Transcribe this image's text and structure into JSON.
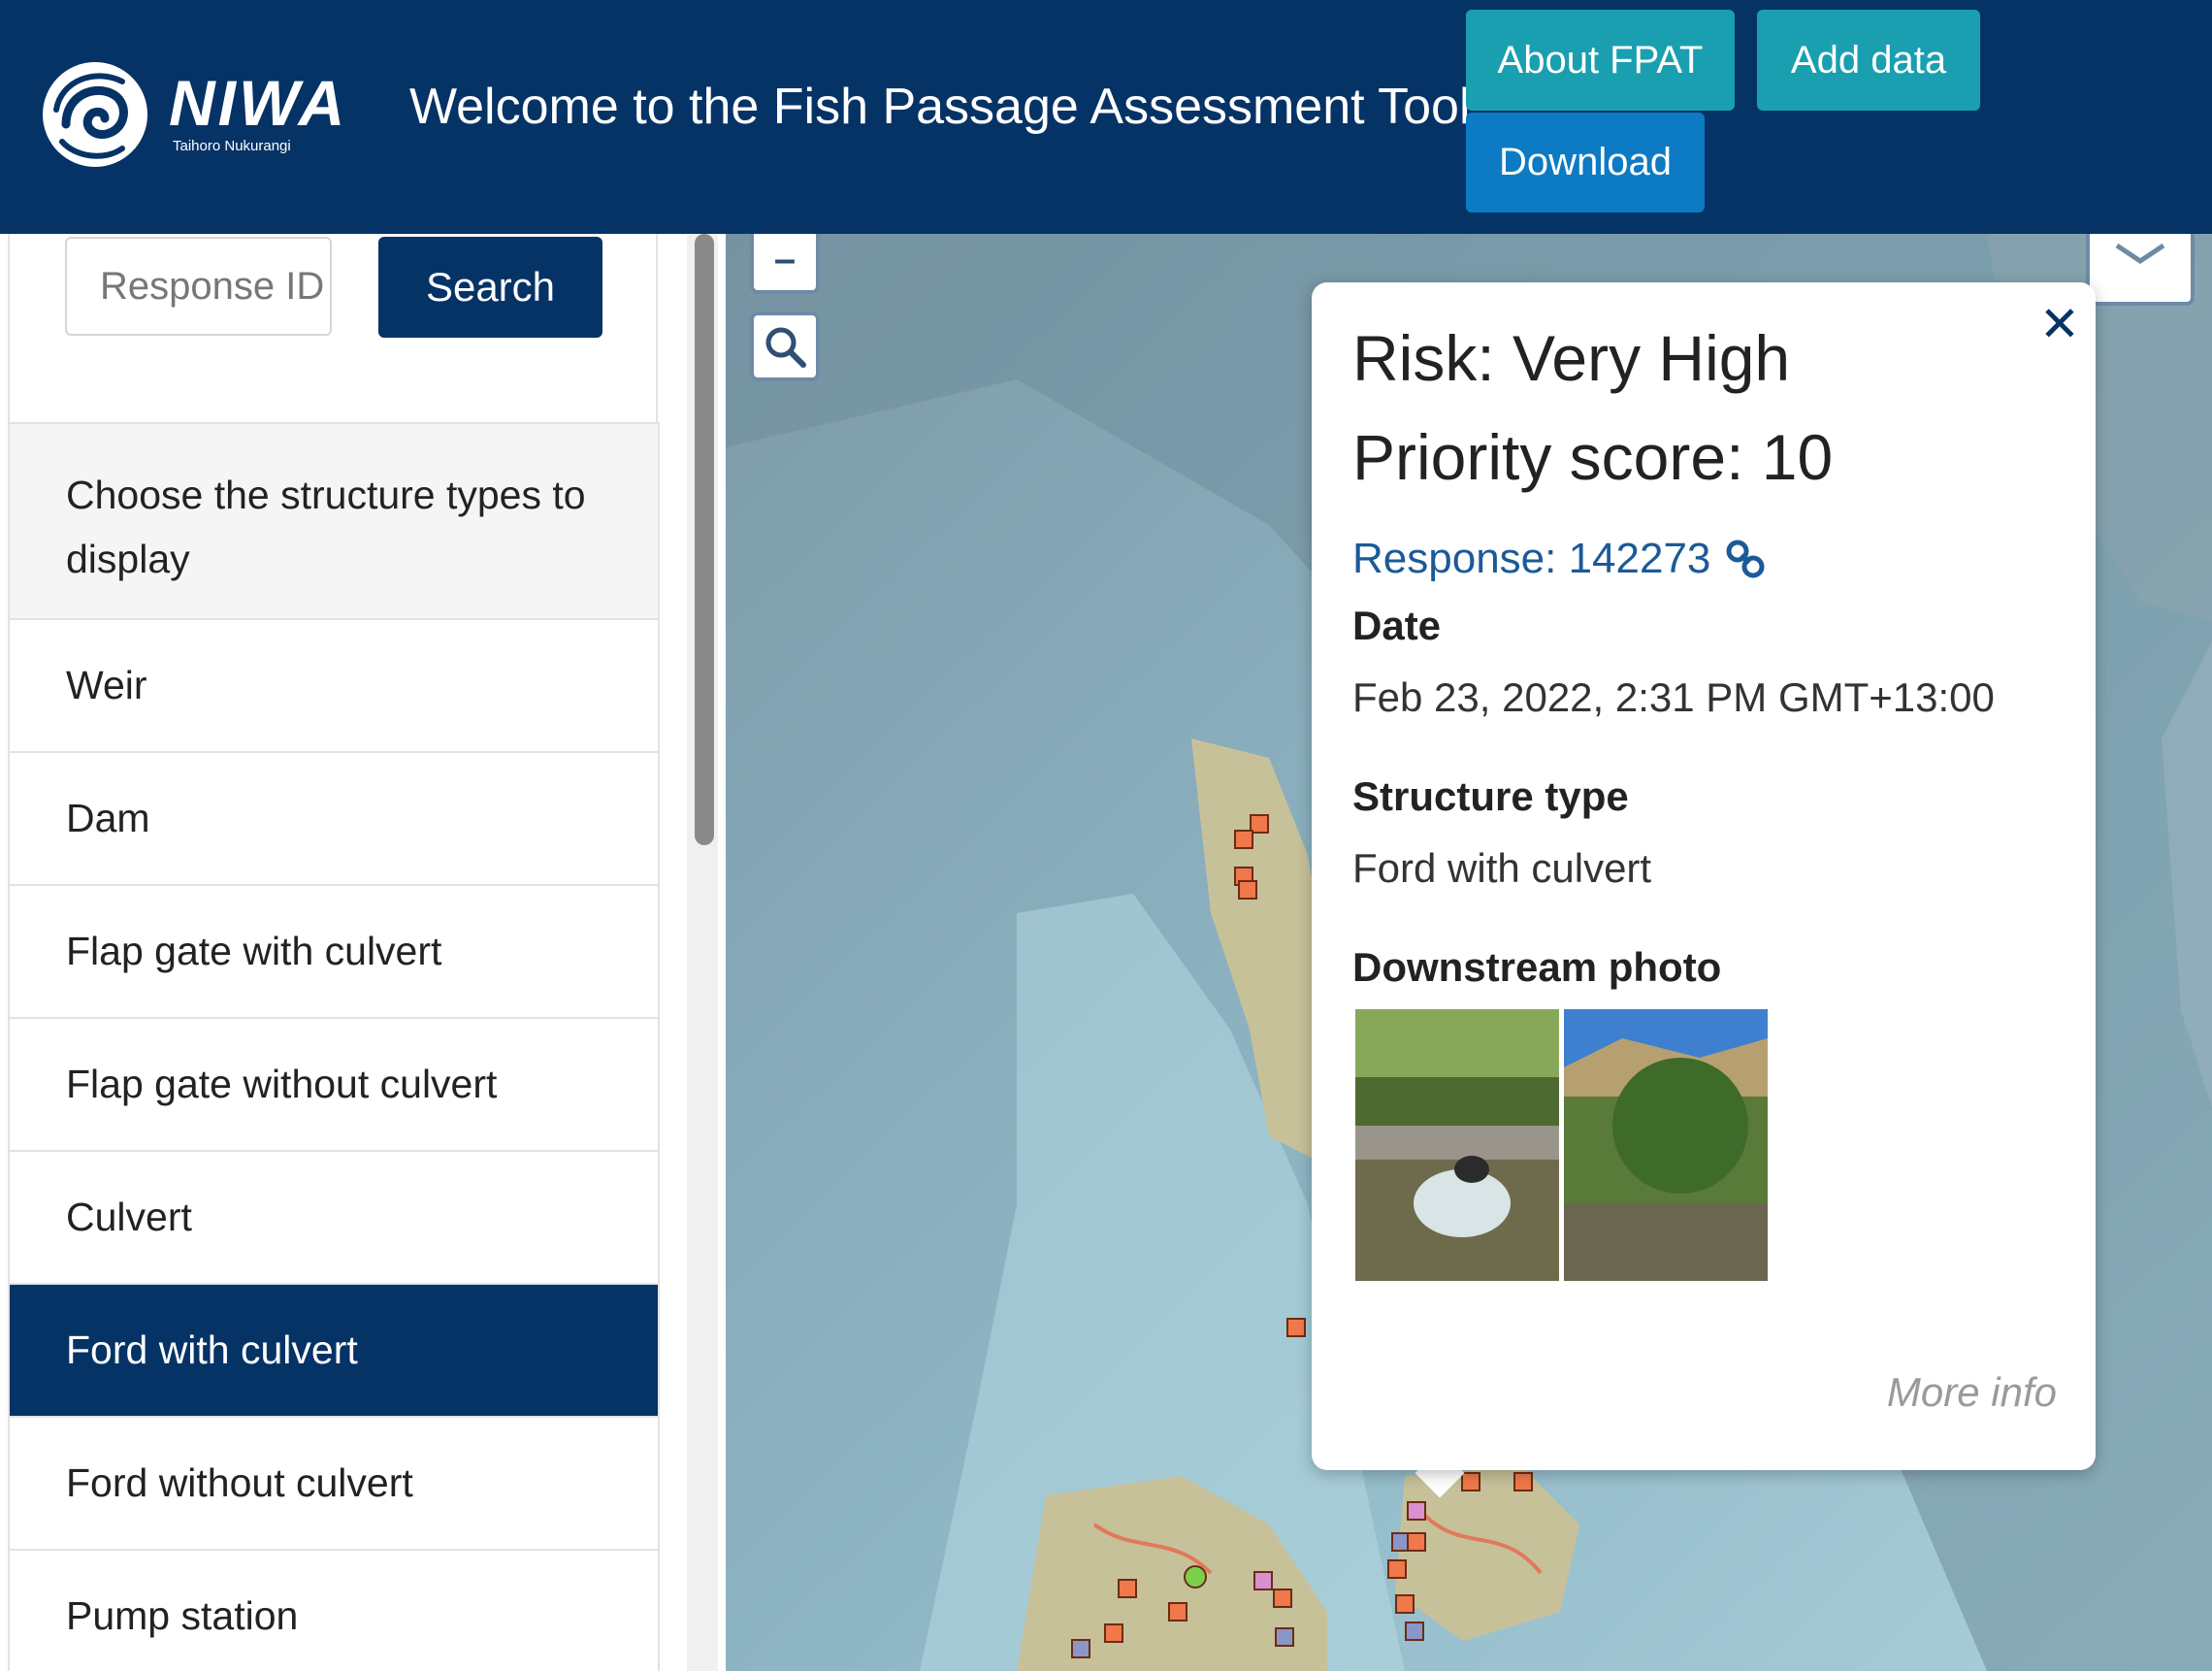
{
  "header": {
    "logo_text": "NIWA",
    "logo_subtext": "Taihoro Nukurangi",
    "title": "Welcome to the Fish Passage Assessment Tool",
    "buttons": {
      "about": "About FPAT",
      "add": "Add data",
      "download": "Download"
    }
  },
  "sidebar": {
    "search": {
      "placeholder": "Response ID",
      "button": "Search"
    },
    "types_heading": "Choose the structure types to display",
    "types": [
      "Weir",
      "Dam",
      "Flap gate with culvert",
      "Flap gate without culvert",
      "Culvert",
      "Ford with culvert",
      "Ford without culvert",
      "Pump station"
    ],
    "selected_type": "Ford with culvert"
  },
  "map": {
    "zoom_out": "–",
    "search_icon": "magnifier-icon"
  },
  "popup": {
    "risk": "Risk: Very High",
    "priority": "Priority score: 10",
    "response": "Response: 142273",
    "date_label": "Date",
    "date_value": "Feb 23, 2022, 2:31 PM GMT+13:00",
    "structure_label": "Structure type",
    "structure_value": "Ford with culvert",
    "photo_label": "Downstream photo",
    "more_info": "More info",
    "close": "✕"
  },
  "colors": {
    "header_bg": "#063366",
    "teal_button": "#1a9fb0",
    "blue_button": "#0d7ac4",
    "link": "#1b5a97",
    "marker_very_high": "#f0784a",
    "marker_pink": "#d98fd0",
    "marker_blue": "#8a95c8",
    "marker_green": "#7ccf4a"
  }
}
